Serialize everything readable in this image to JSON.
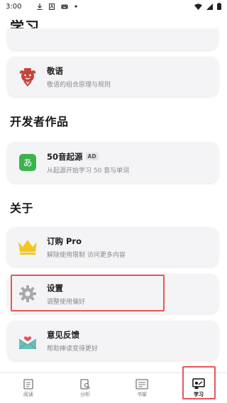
{
  "status_bar": {
    "time": "3:00",
    "notifications": [
      "download-icon",
      "a-box-icon",
      "keyboard-icon",
      "dot-icon"
    ],
    "indicators": [
      "wifi-icon",
      "signal-icon",
      "battery-icon"
    ]
  },
  "page_title": "学习",
  "items": {
    "honorifics": {
      "title": "敬语",
      "subtitle": "敬语的组合原理与规则",
      "icon": "honorific-mascot-icon"
    },
    "gojuon": {
      "title": "50音起源",
      "badge": "AD",
      "subtitle": "从起源开始学习 50 音与单词",
      "icon": "hiragana-app-icon"
    },
    "subscribe": {
      "title": "订购 Pro",
      "subtitle": "解除使用限制 访问更多内容",
      "icon": "crown-icon"
    },
    "settings": {
      "title": "设置",
      "subtitle": "调整使用偏好",
      "icon": "gear-icon"
    },
    "feedback": {
      "title": "意见反馈",
      "subtitle": "帮助捧读变得更好",
      "icon": "envelope-heart-icon"
    }
  },
  "sections": {
    "developer": "开发者作品",
    "about": "关于"
  },
  "tab_bar": {
    "tabs": [
      {
        "label": "阅读",
        "icon": "reading-icon"
      },
      {
        "label": "分析",
        "icon": "analysis-icon"
      },
      {
        "label": "书架",
        "icon": "bookshelf-icon"
      },
      {
        "label": "学习",
        "icon": "study-icon"
      }
    ],
    "active": "学习"
  },
  "colors": {
    "highlight": "#e8555b",
    "card_bg": "#f4f4f6",
    "crown": "#f5c623",
    "app_green": "#3cb44b"
  }
}
